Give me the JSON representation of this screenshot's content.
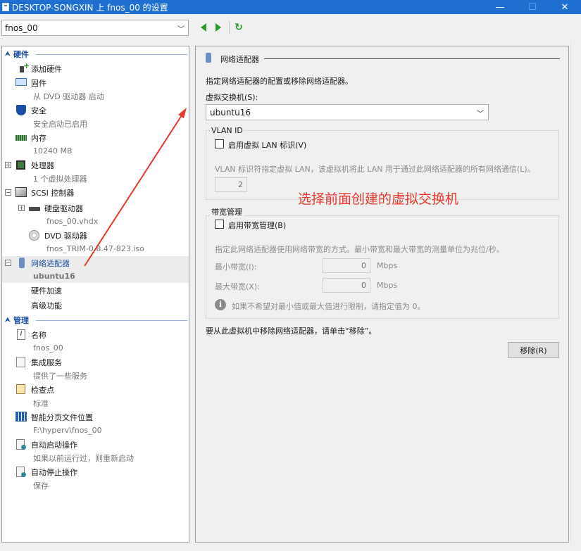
{
  "window": {
    "title": "DESKTOP-SONGXIN 上 fnos_00 的设置",
    "minimize": "—",
    "maximize": "☐",
    "close": "✕"
  },
  "toolbar": {
    "vm_selected": "fnos_00",
    "back_label": "",
    "forward_label": "",
    "refresh_glyph": "↻"
  },
  "sections": {
    "hardware": "硬件",
    "management": "管理"
  },
  "hardware_items": {
    "add_hardware": "添加硬件",
    "firmware": "固件",
    "firmware_sub": "从 DVD 驱动器 启动",
    "security": "安全",
    "security_sub": "安全启动已启用",
    "memory": "内存",
    "memory_sub": "10240 MB",
    "processor": "处理器",
    "processor_sub": "1 个虚拟处理器",
    "scsi": "SCSI 控制器",
    "hdd": "硬盘驱动器",
    "hdd_sub": "fnos_00.vhdx",
    "dvd": "DVD 驱动器",
    "dvd_sub": "fnos_TRIM-0.8.47-823.iso",
    "netadapter": "网络适配器",
    "netadapter_sub": "ubuntu16",
    "hw_accel": "硬件加速",
    "advanced": "高级功能"
  },
  "management_items": {
    "name": "名称",
    "name_sub": "fnos_00",
    "integration": "集成服务",
    "integration_sub": "提供了一些服务",
    "checkpoint": "检查点",
    "checkpoint_sub": "标准",
    "paging": "智能分页文件位置",
    "paging_sub": "F:\\hyperv\\fnos_00",
    "autostart": "自动启动操作",
    "autostart_sub": "如果以前运行过，则重新启动",
    "autostop": "自动停止操作",
    "autostop_sub": "保存"
  },
  "detail": {
    "header": "网络适配器",
    "description": "指定网络适配器的配置或移除网络适配器。",
    "vswitch_label": "虚拟交换机(S):",
    "vswitch_value": "ubuntu16",
    "vlan_group": "VLAN ID",
    "vlan_checkbox": "启用虚拟 LAN 标识(V)",
    "vlan_desc": "VLAN 标识符指定虚拟 LAN，该虚拟机将此 LAN 用于通过此网络适配器的所有网络通信(L)。",
    "vlan_value": "2",
    "bw_group": "带宽管理",
    "bw_checkbox": "启用带宽管理(B)",
    "bw_desc": "指定此网络适配器使用网络带宽的方式。最小带宽和最大带宽的测量单位为兆位/秒。",
    "min_label": "最小带宽(I):",
    "min_value": "0",
    "max_label": "最大带宽(X):",
    "max_value": "0",
    "unit": "Mbps",
    "info_text": "如果不希望对最小值或最大值进行限制，请指定值为 0。",
    "remove_hint": "要从此虚拟机中移除网络适配器，请单击“移除”。",
    "remove_button": "移除(R)"
  },
  "annotation": {
    "text": "选择前面创建的虚拟交换机",
    "color": "#e8392c"
  },
  "colors": {
    "titlebar": "#1f6fd1",
    "section_blue": "#1a4fa0"
  }
}
